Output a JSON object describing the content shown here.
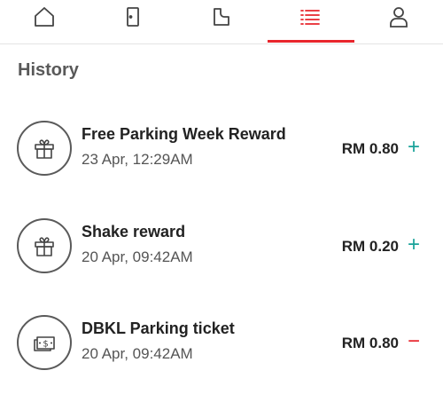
{
  "tabs": [
    {
      "name": "home-icon"
    },
    {
      "name": "phone-icon"
    },
    {
      "name": "ticket-icon"
    },
    {
      "name": "history-list-icon",
      "active": true
    },
    {
      "name": "profile-icon"
    }
  ],
  "colors": {
    "accent": "#e8262d",
    "credit": "#1aa39a",
    "debit": "#e8262d"
  },
  "history": {
    "title": "History",
    "items": [
      {
        "icon": "gift-icon",
        "title": "Free Parking Week Reward",
        "date": "23 Apr, 12:29AM",
        "amount": "RM 0.80",
        "sign": "+"
      },
      {
        "icon": "gift-icon",
        "title": "Shake reward",
        "date": "20 Apr, 09:42AM",
        "amount": "RM 0.20",
        "sign": "+"
      },
      {
        "icon": "ticket-cash-icon",
        "title": "DBKL Parking ticket",
        "date": "20 Apr, 09:42AM",
        "amount": "RM 0.80",
        "sign": "−"
      }
    ]
  }
}
